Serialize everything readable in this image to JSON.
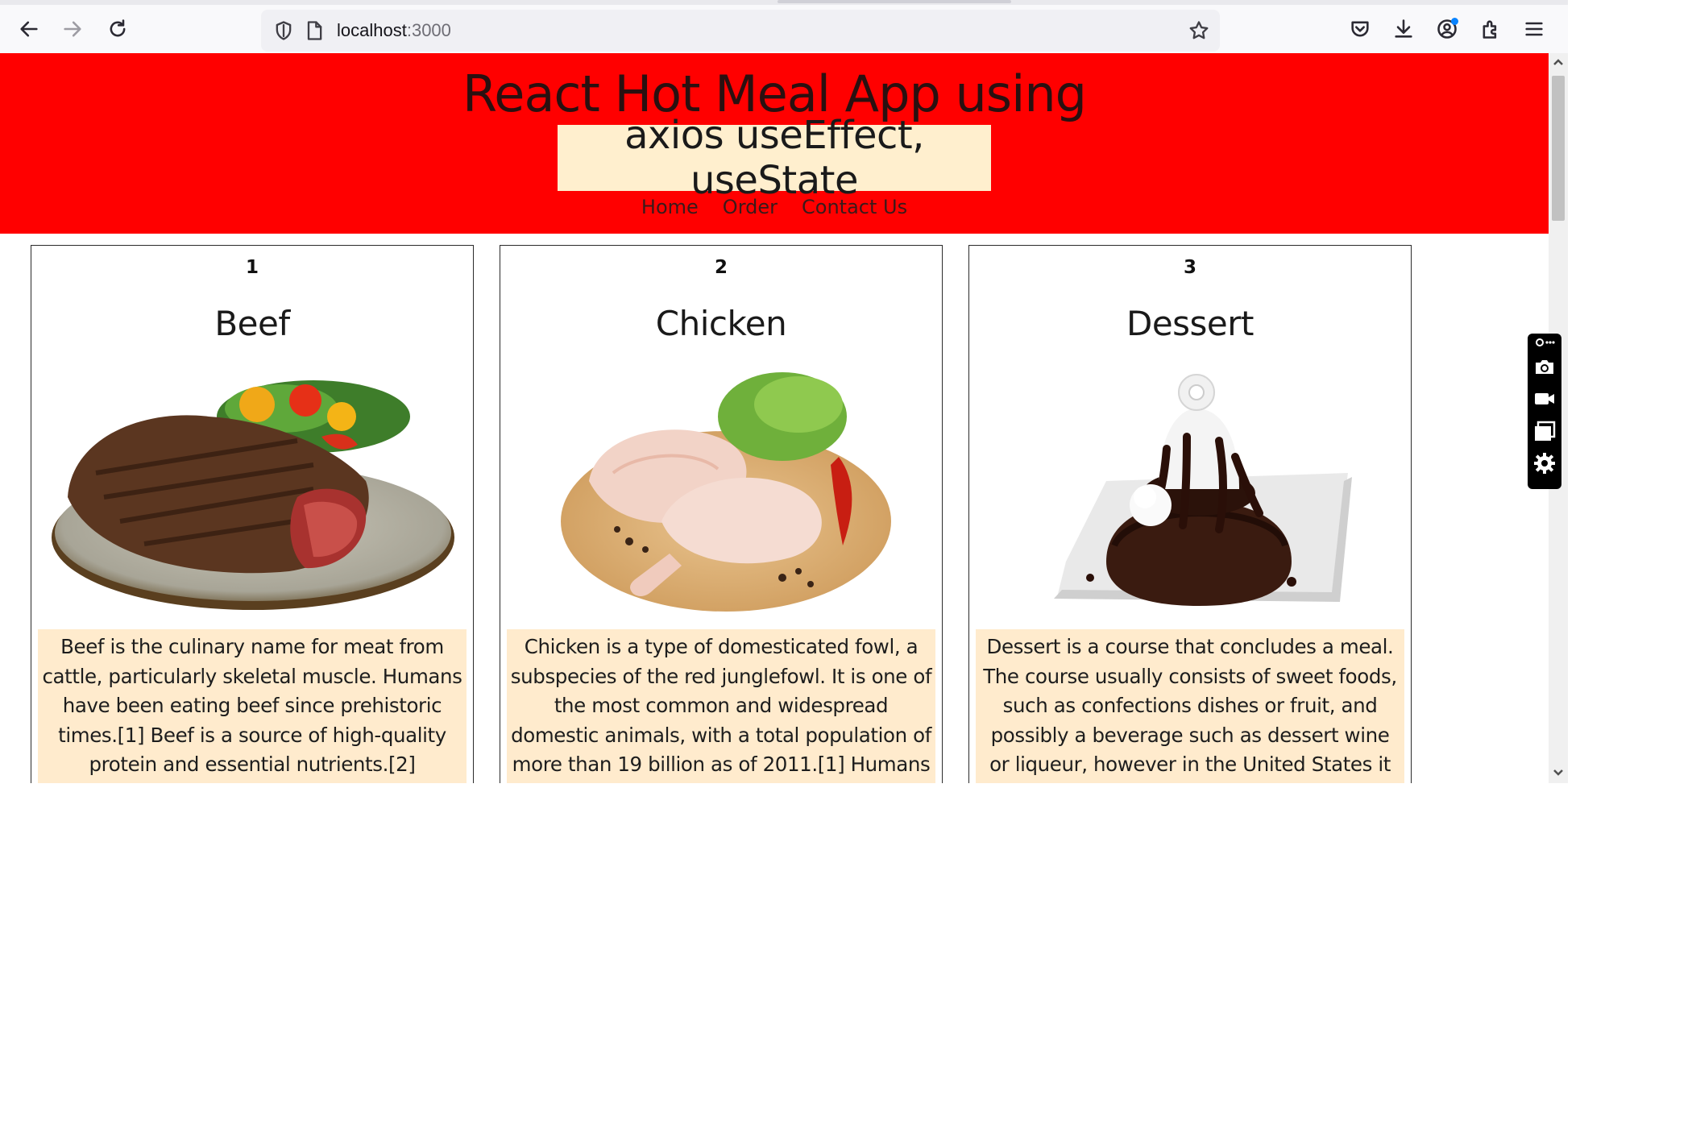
{
  "browser": {
    "url_host": "localhost",
    "url_port": ":3000",
    "icons": [
      "back-icon",
      "forward-icon",
      "reload-icon",
      "shield-icon",
      "page-icon",
      "star-icon",
      "pocket-icon",
      "download-icon",
      "account-icon",
      "extensions-icon",
      "menu-icon"
    ]
  },
  "app": {
    "title": "React Hot Meal App using",
    "subtitle": "axios useEffect, useState",
    "nav": [
      "Home",
      "Order",
      "Contact Us"
    ],
    "colors": {
      "header_bg": "#ff0000",
      "highlight_bg": "#ffefce",
      "desc_bg": "#ffebcd"
    }
  },
  "cards": [
    {
      "id": "1",
      "name": "Beef",
      "image": "steak-on-plate-image",
      "description": "Beef is the culinary name for meat from cattle, particularly skeletal muscle. Humans have been eating beef since prehistoric times.[1] Beef is a source of high-quality protein and essential nutrients.[2]"
    },
    {
      "id": "2",
      "name": "Chicken",
      "image": "raw-chicken-legs-on-board-image",
      "description": "Chicken is a type of domesticated fowl, a subspecies of the red junglefowl. It is one of the most common and widespread domestic animals, with a total population of more than 19 billion as of 2011.[1] Humans commonly keep chickens as"
    },
    {
      "id": "3",
      "name": "Dessert",
      "image": "chocolate-lava-cake-image",
      "description": "Dessert is a course that concludes a meal. The course usually consists of sweet foods, such as confections dishes or fruit, and possibly a beverage such as dessert wine or liqueur, however in the United States it may include"
    }
  ],
  "capture_toolbar": {
    "icons": [
      "pin-icon",
      "camera-icon",
      "video-icon",
      "window-icon",
      "gear-icon"
    ]
  }
}
